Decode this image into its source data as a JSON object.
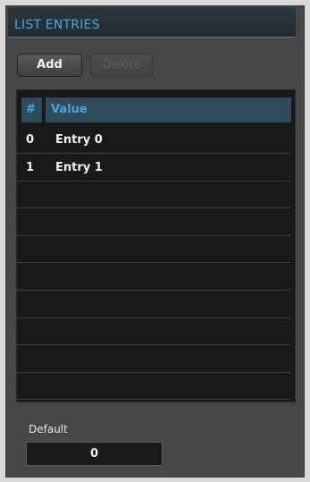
{
  "panel": {
    "title": "LIST ENTRIES"
  },
  "toolbar": {
    "add_label": "Add",
    "delete_label": "Delete"
  },
  "table": {
    "headers": {
      "num": "#",
      "value": "Value"
    },
    "rows": [
      {
        "num": "0",
        "value": "Entry 0"
      },
      {
        "num": "1",
        "value": "Entry 1"
      }
    ],
    "empty_row_count": 8
  },
  "default": {
    "label": "Default",
    "value": "0"
  }
}
